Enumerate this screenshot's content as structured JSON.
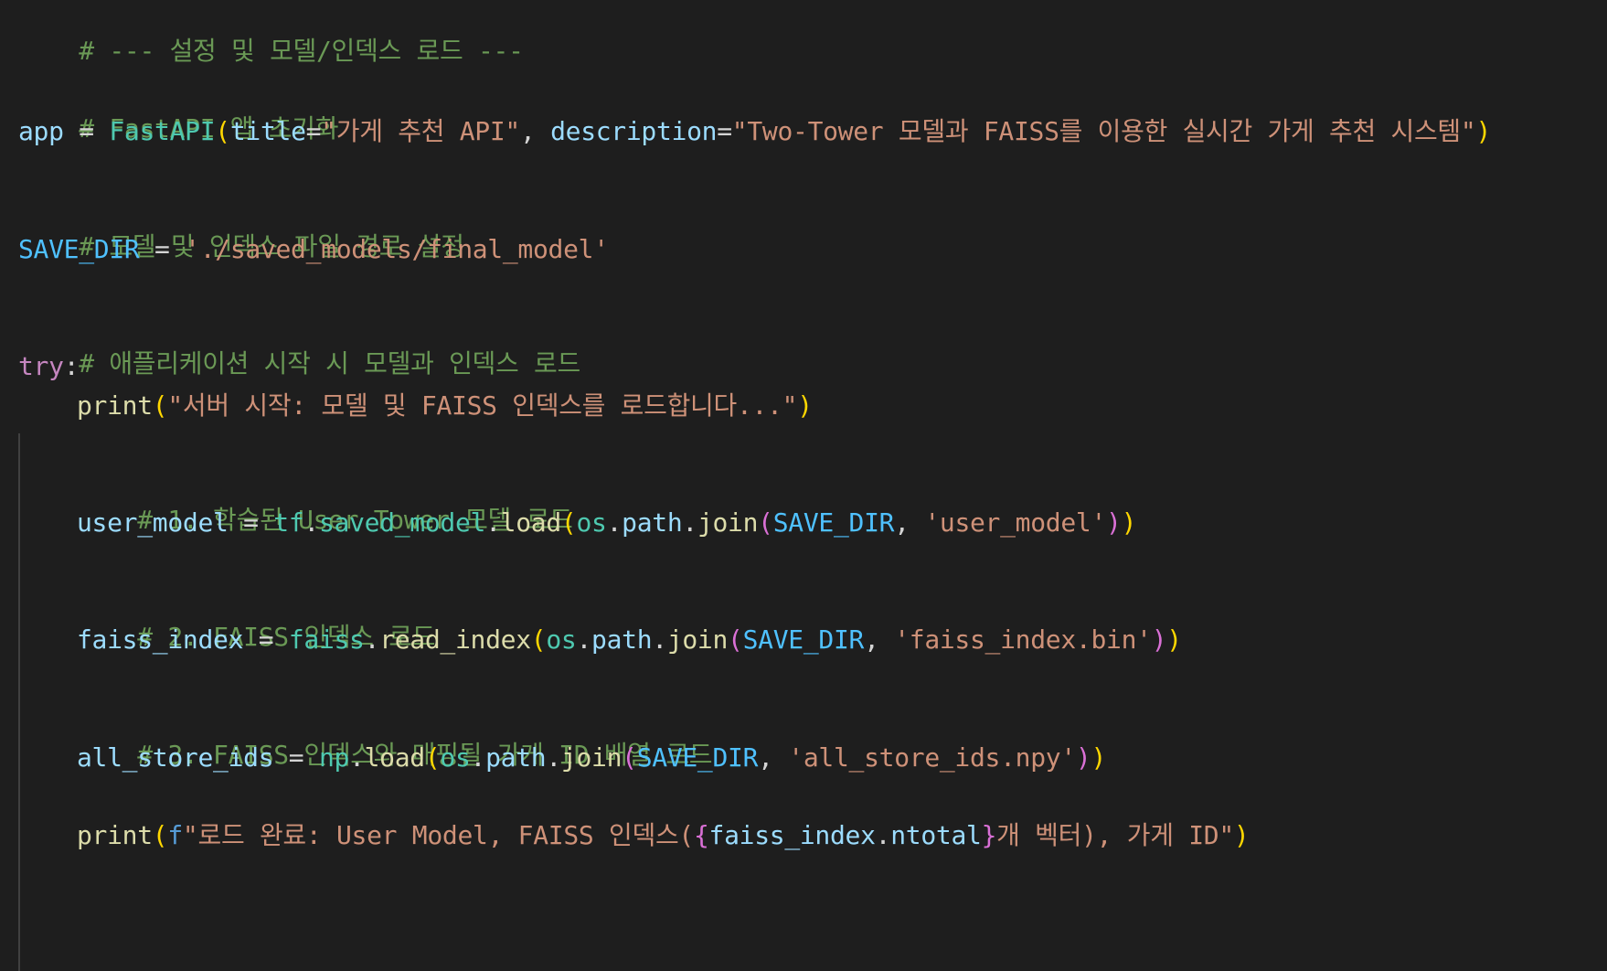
{
  "lines": {
    "l1": "# --- 설정 및 모델/인덱스 로드 ---",
    "l3": "# FastAPI 앱 초기화",
    "l4": {
      "var": "app",
      "op": " = ",
      "cls": "FastAPI",
      "open": "(",
      "param1": "title",
      "eq1": "=",
      "str1": "\"가게 추천 API\"",
      "comma": ", ",
      "param2": "description",
      "eq2": "=",
      "str2": "\"Two-Tower 모델과 FAISS를 이용한 실시간 가게 추천 시스템\"",
      "close": ")"
    },
    "l6": "# 모델 및 인덱스 파일 경로 설정",
    "l7": {
      "const": "SAVE_DIR",
      "op": " = ",
      "str": "'./saved_models/final_model'"
    },
    "l9": "# 애플리케이션 시작 시 모델과 인덱스 로드",
    "l10": {
      "kw": "try",
      "colon": ":"
    },
    "l11": {
      "func": "print",
      "open": "(",
      "str": "\"서버 시작: 모델 및 FAISS 인덱스를 로드합니다...\"",
      "close": ")"
    },
    "l13": "# 1. 학습된 User Tower 모델 로드",
    "l14": {
      "var": "user_model",
      "op": " = ",
      "mod1": "tf",
      "dot1": ".",
      "mod2": "saved_model",
      "dot2": ".",
      "func": "load",
      "open1": "(",
      "mod3": "os",
      "dot3": ".",
      "mod4": "path",
      "dot4": ".",
      "func2": "join",
      "open2": "(",
      "const": "SAVE_DIR",
      "comma": ", ",
      "str": "'user_model'",
      "close2": ")",
      "close1": ")"
    },
    "l16": "# 2. FAISS 인덱스 로드",
    "l17": {
      "var": "faiss_index",
      "op": " = ",
      "mod1": "faiss",
      "dot1": ".",
      "func": "read_index",
      "open1": "(",
      "mod2": "os",
      "dot2": ".",
      "mod3": "path",
      "dot3": ".",
      "func2": "join",
      "open2": "(",
      "const": "SAVE_DIR",
      "comma": ", ",
      "str": "'faiss_index.bin'",
      "close2": ")",
      "close1": ")"
    },
    "l19": "# 3. FAISS 인덱스와 매핑될 가게 ID 배열 로드",
    "l20": {
      "var": "all_store_ids",
      "op": " = ",
      "mod1": "np",
      "dot1": ".",
      "func": "load",
      "open1": "(",
      "mod2": "os",
      "dot2": ".",
      "mod3": "path",
      "dot3": ".",
      "func2": "join",
      "open2": "(",
      "const": "SAVE_DIR",
      "comma": ", ",
      "str": "'all_store_ids.npy'",
      "close2": ")",
      "close1": ")"
    },
    "l22": {
      "func": "print",
      "open": "(",
      "fprefix": "f",
      "str1": "\"로드 완료: User Model, FAISS 인덱스(",
      "brace_open": "{",
      "var": "faiss_index",
      "dot": ".",
      "attr": "ntotal",
      "brace_close": "}",
      "str2": "개 벡터), 가게 ID\"",
      "close": ")"
    }
  },
  "colors": {
    "background": "#1e1e1e",
    "comment": "#6a9955",
    "variable": "#9cdcfe",
    "constant": "#4fc1ff",
    "class": "#4ec9b0",
    "function": "#dcdcaa",
    "string": "#ce9178",
    "keyword": "#c586c0",
    "bracket_level1": "#ffd700",
    "bracket_level2": "#da70d6",
    "bracket_level3": "#179fff"
  }
}
